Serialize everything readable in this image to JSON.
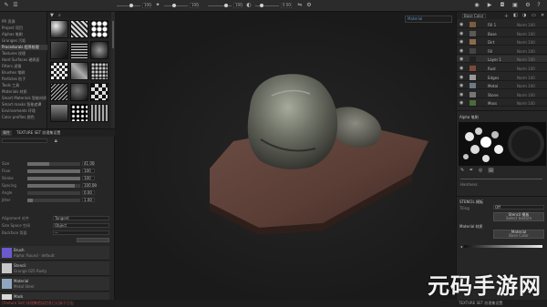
{
  "topbar": {
    "values": [
      "100",
      "100",
      "100",
      "0.00"
    ],
    "slider_levels": [
      0.55,
      0.35,
      0.7,
      0.2
    ],
    "icons": [
      "brush-icon",
      "eraser-icon",
      "projection-icon",
      "picker-icon",
      "symmetry-icon",
      "camera-icon",
      "video-icon",
      "settings-icon"
    ]
  },
  "shelf": {
    "categories": [
      "PR 资源",
      "Project 项目",
      "Alphas 笔刷",
      "Grunges 污垢",
      "Procedurals 程序纹理",
      "Textures 纹理",
      "Hard Surfaces 硬表面",
      "Filters 滤镜",
      "Brushes 笔刷",
      "Particles 粒子",
      "Tools 工具",
      "Materials 材质",
      "Smart Materials 智能材质",
      "Smart masks 智能遮罩",
      "Environments 环境",
      "Color profiles 颜色"
    ],
    "active_index": 4,
    "thumb_icons": [
      "procedural-thumb-icon"
    ]
  },
  "properties": {
    "tabs": [
      "属性",
      "TEXTURE SET 纹理集设置"
    ],
    "rows": [
      {
        "label": "Size",
        "value": "41.00",
        "level": 0.41
      },
      {
        "label": "Flow",
        "value": "100",
        "level": 1.0
      },
      {
        "label": "Stroke",
        "value": "100",
        "level": 1.0
      },
      {
        "label": "Spacing",
        "value": "100.00",
        "level": 0.9
      },
      {
        "label": "Angle",
        "value": "0.00",
        "level": 0.0
      },
      {
        "label": "Jitter",
        "value": "1.00",
        "level": 0.1
      }
    ],
    "drops": [
      {
        "label": "Alignment 对齐",
        "value": "Tangent"
      },
      {
        "label": "Size Space 空间",
        "value": "Object"
      },
      {
        "label": "Backface 背面",
        "value": "—"
      }
    ],
    "stack": [
      {
        "t1": "Brush",
        "t2": "Alpha: Round · default",
        "color": "#6a5acd"
      },
      {
        "t1": "Stencil",
        "t2": "Grunge 025 Rusty",
        "color": "#c8c8c8"
      },
      {
        "t1": "Material",
        "t2": "Metal Steel",
        "color": "#8fa8c0"
      },
      {
        "t1": "Mask",
        "t2": "Pattern Grid",
        "color": "#d8d8d8"
      }
    ],
    "status": "[Texture Set] 纹理集错误信息已记录于日志"
  },
  "viewport": {
    "mode": "Material",
    "accent": "#5a8ec4"
  },
  "layers": {
    "mode_label": "Base Color",
    "items": [
      {
        "name": "Fill 1",
        "mode": "Norm 100"
      },
      {
        "name": "Base",
        "mode": "Norm 100"
      },
      {
        "name": "Dirt",
        "mode": "Norm 100"
      },
      {
        "name": "Fill",
        "mode": "Norm 100"
      },
      {
        "name": "Layer 1",
        "mode": "Norm 100"
      },
      {
        "name": "Rust",
        "mode": "Norm 100"
      },
      {
        "name": "Edges",
        "mode": "Norm 100"
      },
      {
        "name": "Metal",
        "mode": "Norm 100"
      },
      {
        "name": "Stone",
        "mode": "Norm 100"
      },
      {
        "name": "Moss",
        "mode": "Norm 100"
      }
    ]
  },
  "brush_panel": {
    "title": "Alpha 笔刷",
    "slider_label": "Hardness",
    "icons": [
      "brush-icon",
      "pen-icon",
      "pressure-icon",
      "tilt-icon"
    ]
  },
  "texture_panel": {
    "title": "STENCIL 模板",
    "row_label": "Tiling",
    "row_value": "Off",
    "button1": "Stencil 模板",
    "button1_sub": "Select texture",
    "section2": "Material 材质",
    "button2": "Material",
    "button2_sub": "Base Color"
  },
  "right_status": "TEXTURE SET 纹理集设置",
  "watermark": "元码手游网"
}
